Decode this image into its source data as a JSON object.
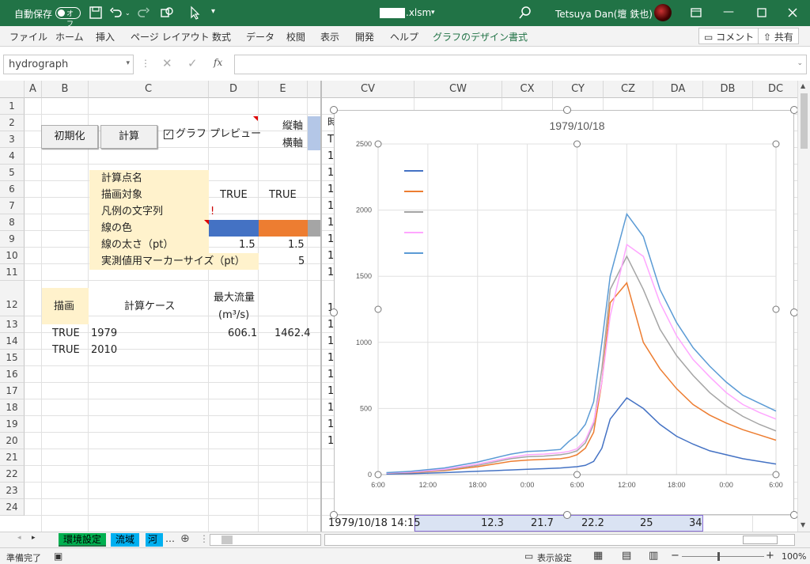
{
  "titlebar": {
    "autosave_label": "自動保存",
    "autosave_state": "オフ",
    "filename_suffix": ".xlsm",
    "user_name": "Tetsuya Dan(壇 鉄也)"
  },
  "menu": {
    "items": [
      "ファイル",
      "ホーム",
      "挿入",
      "ページ レイアウト",
      "数式",
      "データ",
      "校閲",
      "表示",
      "開発",
      "ヘルプ",
      "グラフのデザイン",
      "書式"
    ],
    "comment_btn": "コメント",
    "share_btn": "共有"
  },
  "formula_bar": {
    "name_box": "hydrograph",
    "fx": "fx"
  },
  "columns_left": [
    "A",
    "B",
    "C",
    "D",
    "E"
  ],
  "columns_right": [
    "CV",
    "CW",
    "CX",
    "CY",
    "CZ",
    "DA",
    "DB",
    "DC"
  ],
  "rows": [
    "1",
    "2",
    "3",
    "4",
    "5",
    "6",
    "7",
    "8",
    "9",
    "10",
    "11",
    "12",
    "13",
    "14",
    "15",
    "16",
    "17",
    "18",
    "19",
    "20",
    "21",
    "22",
    "23",
    "24"
  ],
  "controls": {
    "init_button": "初期化",
    "calc_button": "計算",
    "preview_checkbox": "グラフ プレビュー",
    "vaxis": "縦軸",
    "haxis": "横軸"
  },
  "labels": {
    "point_name": "計算点名",
    "target": "描画対象",
    "legend_text": "凡例の文字列",
    "line_color": "線の色",
    "line_width": "線の太さ（pt）",
    "marker_size": "実測値用マーカーサイズ（pt）"
  },
  "values": {
    "target_d": "TRUE",
    "target_e": "TRUE",
    "legend_d": "!",
    "width_d": "1.5",
    "width_e": "1.5",
    "marker_e": "5"
  },
  "colors": {
    "line_color_d": "#4472C4",
    "line_color_e": "#ED7D31",
    "line_color_f": "#A5A5A5",
    "excel_green": "#217346"
  },
  "table": {
    "header_draw": "描画",
    "header_case": "計算ケース",
    "header_peak_line1": "最大流量",
    "header_peak_unit": "(m³/s)",
    "rows": [
      {
        "draw": "TRUE",
        "case": "1979",
        "d": "606.1",
        "e": "1462.4"
      },
      {
        "draw": "TRUE",
        "case": "2010",
        "d": "",
        "e": ""
      }
    ]
  },
  "right_col_partial": [
    "時",
    "T",
    "1",
    "1",
    "1",
    "1",
    "1",
    "1",
    "1",
    "1",
    "1",
    "1",
    "1",
    "1",
    "1",
    "1",
    "1",
    "1",
    "1"
  ],
  "row24_right": {
    "time": "1979/10/18 14:15",
    "v1": "12.3",
    "v2": "21.7",
    "v3": "22.2",
    "v4": "25",
    "v5": "34"
  },
  "chart_data": {
    "type": "line",
    "title": "1979/10/18",
    "xlabel": "",
    "ylabel": "",
    "ylim": [
      0,
      2500
    ],
    "y_ticks": [
      "0",
      "500",
      "1000",
      "1500",
      "2000",
      "2500"
    ],
    "x_ticks": [
      "6:00",
      "12:00",
      "18:00",
      "0:00",
      "6:00",
      "12:00",
      "18:00",
      "0:00",
      "6:00"
    ],
    "grid": true,
    "legend_placement": "top-left",
    "series": [
      {
        "color": "#4472C4",
        "x": [
          0.5,
          2,
          4,
          6,
          7,
          8,
          9,
          10,
          11,
          11.5,
          12,
          12.5,
          13,
          13.5,
          14,
          15,
          16,
          17,
          18,
          19,
          20,
          21,
          22,
          23,
          24
        ],
        "values": [
          5,
          8,
          15,
          25,
          30,
          35,
          40,
          45,
          50,
          55,
          60,
          70,
          100,
          200,
          420,
          580,
          500,
          380,
          290,
          230,
          180,
          150,
          120,
          100,
          80
        ]
      },
      {
        "color": "#ED7D31",
        "x": [
          0.5,
          2,
          4,
          6,
          7,
          8,
          9,
          10,
          11,
          11.5,
          12,
          12.5,
          13,
          13.5,
          14,
          15,
          16,
          17,
          18,
          19,
          20,
          21,
          22,
          23,
          24
        ],
        "values": [
          10,
          15,
          30,
          60,
          80,
          100,
          110,
          115,
          120,
          130,
          150,
          200,
          320,
          700,
          1300,
          1450,
          1000,
          800,
          650,
          530,
          450,
          390,
          340,
          300,
          260
        ]
      },
      {
        "color": "#A5A5A5",
        "x": [
          0.5,
          2,
          4,
          6,
          7,
          8,
          9,
          10,
          11,
          11.5,
          12,
          12.5,
          13,
          13.5,
          14,
          15,
          16,
          17,
          18,
          19,
          20,
          21,
          22,
          23,
          24
        ],
        "values": [
          10,
          18,
          35,
          70,
          95,
          120,
          135,
          140,
          150,
          160,
          180,
          240,
          380,
          800,
          1400,
          1650,
          1400,
          1100,
          900,
          750,
          620,
          520,
          440,
          380,
          330
        ]
      },
      {
        "color": "#FFA6FF",
        "x": [
          0.5,
          2,
          4,
          6,
          7,
          8,
          9,
          10,
          11,
          11.5,
          12,
          12.5,
          13,
          13.5,
          14,
          15,
          16,
          17,
          18,
          19,
          20,
          21,
          22,
          23,
          24
        ],
        "values": [
          12,
          20,
          40,
          80,
          105,
          130,
          150,
          155,
          165,
          175,
          195,
          260,
          400,
          700,
          1200,
          1740,
          1650,
          1300,
          1050,
          870,
          740,
          620,
          530,
          470,
          420
        ]
      },
      {
        "color": "#5B9BD5",
        "x": [
          0.5,
          2,
          4,
          6,
          7,
          8,
          9,
          10,
          11,
          11.5,
          12,
          12.5,
          13,
          13.5,
          14,
          15,
          16,
          17,
          18,
          19,
          20,
          21,
          22,
          23,
          24
        ],
        "values": [
          15,
          25,
          50,
          95,
          125,
          155,
          175,
          180,
          190,
          250,
          300,
          380,
          550,
          1000,
          1500,
          1970,
          1800,
          1400,
          1150,
          960,
          820,
          700,
          600,
          540,
          480
        ]
      }
    ]
  },
  "sheets": [
    "環境設定",
    "流域",
    "河"
  ],
  "status": {
    "ready": "準備完了",
    "display_settings": "表示設定",
    "zoom": "100%"
  }
}
